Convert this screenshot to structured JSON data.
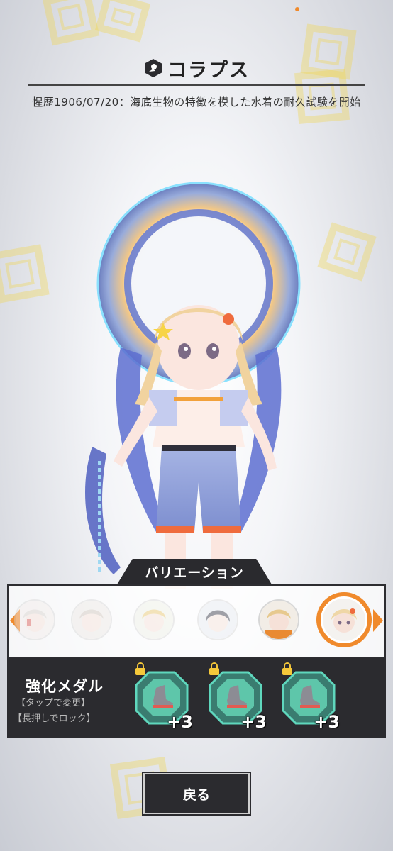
{
  "header": {
    "title": "コラプス",
    "icon": "hexagon-badge-icon"
  },
  "history": {
    "label": "惺歴1906/07/20：",
    "text": "海底生物の特徴を模した水着の耐久試験を開始"
  },
  "variation": {
    "tab_label": "バリエーション",
    "thumbnails": [
      {
        "name": "variant-1",
        "selected": false
      },
      {
        "name": "variant-2",
        "selected": false
      },
      {
        "name": "variant-3",
        "selected": false
      },
      {
        "name": "variant-4",
        "selected": false
      },
      {
        "name": "variant-5",
        "selected": false
      },
      {
        "name": "variant-6",
        "selected": true
      }
    ],
    "accent_color": "#f08a2c"
  },
  "medals": {
    "title": "強化メダル",
    "hint_tap": "【タップで変更】",
    "hint_hold": "【長押しでロック】",
    "items": [
      {
        "level": "+3",
        "icon": "boot-medal-icon",
        "lock": "lock-icon"
      },
      {
        "level": "+3",
        "icon": "boot-medal-icon",
        "lock": "lock-icon"
      },
      {
        "level": "+3",
        "icon": "boot-medal-icon",
        "lock": "lock-icon"
      }
    ]
  },
  "footer": {
    "back_label": "戻る"
  }
}
